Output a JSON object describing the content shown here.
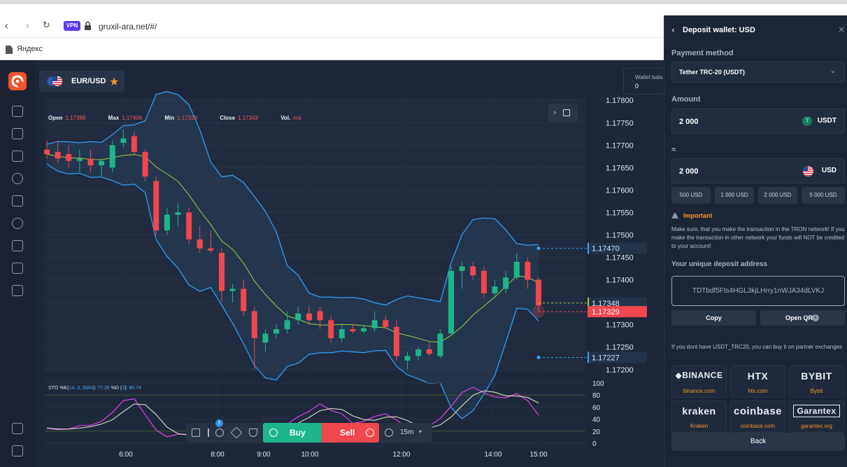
{
  "browser": {
    "url": "gruxil-ara.net/#/",
    "vpn_badge": "VPN",
    "bookmark": "Яндекс"
  },
  "top_bar": {
    "pair": "EUR/USD",
    "wallet_label": "Wallet bala",
    "wallet_value": "0"
  },
  "ohlc": {
    "open_label": "Open",
    "open": "1.17388",
    "max_label": "Max",
    "max": "1.17406",
    "min_label": "Min",
    "min": "1.17329",
    "close_label": "Close",
    "close": "1.17343",
    "vol_label": "Vol.",
    "vol": "n/a"
  },
  "stoch_label": {
    "prefix": "STO %K(",
    "params": "14, 3, SMA",
    "mid": "): ",
    "k": "77.26",
    "d_label": " %D (",
    "d_param": "3",
    "d_mid": "): ",
    "d": "80.74"
  },
  "toolbar": {
    "buy_label": "Buy",
    "sell_label": "Sell",
    "timeframe": "15m",
    "badge": "2"
  },
  "chart_data": {
    "type": "candlestick",
    "price_ticks": [
      "1.17800",
      "1.17750",
      "1.17700",
      "1.17650",
      "1.17600",
      "1.17550",
      "1.17500",
      "1.17450",
      "1.17400",
      "1.17350",
      "1.17300",
      "1.17250",
      "1.17200"
    ],
    "price_range": [
      1.17195,
      1.17805
    ],
    "time_ticks": [
      "6:00",
      "8:00",
      "9:00",
      "10:00",
      "12:00",
      "14:00",
      "15:00"
    ],
    "labels": {
      "upper_band": "1.17470",
      "middle": "1.17348",
      "current": "1.17329",
      "lower_band": "1.17227"
    },
    "stoch_ticks": [
      "100",
      "80",
      "60",
      "40",
      "20",
      "0"
    ],
    "candles": [
      [
        1.1769,
        1.1771,
        1.1767,
        1.1768
      ],
      [
        1.17685,
        1.1771,
        1.1766,
        1.1767
      ],
      [
        1.1768,
        1.177,
        1.1765,
        1.17665
      ],
      [
        1.17665,
        1.1769,
        1.1764,
        1.1767
      ],
      [
        1.1767,
        1.1769,
        1.1764,
        1.17655
      ],
      [
        1.17655,
        1.1767,
        1.1763,
        1.17665
      ],
      [
        1.1765,
        1.1771,
        1.1764,
        1.177
      ],
      [
        1.17705,
        1.17735,
        1.17695,
        1.17715
      ],
      [
        1.1772,
        1.1773,
        1.1768,
        1.17685
      ],
      [
        1.17685,
        1.1769,
        1.1762,
        1.1763
      ],
      [
        1.1762,
        1.1763,
        1.175,
        1.1751
      ],
      [
        1.1751,
        1.1756,
        1.175,
        1.17545
      ],
      [
        1.17545,
        1.1757,
        1.1752,
        1.1755
      ],
      [
        1.1755,
        1.1756,
        1.1748,
        1.1749
      ],
      [
        1.1749,
        1.1752,
        1.1746,
        1.1747
      ],
      [
        1.1747,
        1.1751,
        1.1746,
        1.17465
      ],
      [
        1.1746,
        1.1747,
        1.1735,
        1.17375
      ],
      [
        1.17375,
        1.1739,
        1.1735,
        1.1738
      ],
      [
        1.1738,
        1.174,
        1.1732,
        1.1733
      ],
      [
        1.1733,
        1.1734,
        1.172,
        1.1727
      ],
      [
        1.1726,
        1.1729,
        1.1724,
        1.1728
      ],
      [
        1.1728,
        1.173,
        1.1727,
        1.1729
      ],
      [
        1.1729,
        1.1733,
        1.1728,
        1.1731
      ],
      [
        1.1731,
        1.1734,
        1.173,
        1.17325
      ],
      [
        1.17325,
        1.1734,
        1.173,
        1.1731
      ],
      [
        1.1733,
        1.1734,
        1.1729,
        1.1731
      ],
      [
        1.1731,
        1.1732,
        1.1726,
        1.1727
      ],
      [
        1.1727,
        1.173,
        1.1726,
        1.1729
      ],
      [
        1.1729,
        1.173,
        1.1728,
        1.17285
      ],
      [
        1.17285,
        1.173,
        1.1728,
        1.17292
      ],
      [
        1.17292,
        1.1733,
        1.17285,
        1.1731
      ],
      [
        1.1731,
        1.1732,
        1.1729,
        1.17295
      ],
      [
        1.17295,
        1.1731,
        1.1722,
        1.1723
      ],
      [
        1.1722,
        1.1724,
        1.172,
        1.1723
      ],
      [
        1.1723,
        1.1725,
        1.1722,
        1.17245
      ],
      [
        1.17245,
        1.1726,
        1.1723,
        1.17235
      ],
      [
        1.1723,
        1.1729,
        1.17225,
        1.1728
      ],
      [
        1.1728,
        1.1743,
        1.1728,
        1.1742
      ],
      [
        1.1742,
        1.1744,
        1.1738,
        1.1743
      ],
      [
        1.1743,
        1.1744,
        1.174,
        1.1741
      ],
      [
        1.1742,
        1.1743,
        1.1736,
        1.1737
      ],
      [
        1.1737,
        1.174,
        1.1736,
        1.17385
      ],
      [
        1.1738,
        1.1742,
        1.1737,
        1.17405
      ],
      [
        1.17405,
        1.1746,
        1.174,
        1.1744
      ],
      [
        1.1744,
        1.1745,
        1.1738,
        1.174
      ],
      [
        1.174,
        1.17406,
        1.17329,
        1.17343
      ]
    ]
  },
  "deposit": {
    "title": "Deposit wallet: USD",
    "payment_method_label": "Payment method",
    "payment_method": "Tether TRC-20 (USDT)",
    "amount_label": "Amount",
    "amount_value": "2 000",
    "amount_currency": "USDT",
    "approx_label": "≈",
    "approx_value": "2 000",
    "approx_currency": "USD",
    "presets": [
      "500 USD",
      "1 000 USD",
      "2 000 USD",
      "5 000 USD"
    ],
    "important_label": "Important",
    "important_text": "Make sure, that you make the transaction in the TRON network! If you make the transaction in other network your funds will NOT be credited to your account!",
    "address_label": "Your unique deposit address",
    "address": "TDTbdf5Fts4HGL3kjLHrry1nWJA34dLVKJ",
    "copy_label": "Copy",
    "openqr_label": "Open QR",
    "buy_note": "If you dont have USDT_TRC20, you can buy it on partner exchanges",
    "exchanges": [
      {
        "logo": "◆BINANCE",
        "link": "binance.com"
      },
      {
        "logo": "HTX",
        "link": "htx.com"
      },
      {
        "logo": "BYBIT",
        "link": "Bybit"
      },
      {
        "logo": "kraken",
        "link": "Kraken"
      },
      {
        "logo": "coinbase",
        "link": "coinbase.com"
      },
      {
        "logo": "Garantex",
        "link": "garantex.org"
      }
    ],
    "back_label": "Back"
  },
  "colors": {
    "up": "#1db589",
    "down": "#f1474e",
    "band": "#2ea3ff",
    "ma": "#9ccc3c",
    "accent": "#f5932a"
  }
}
